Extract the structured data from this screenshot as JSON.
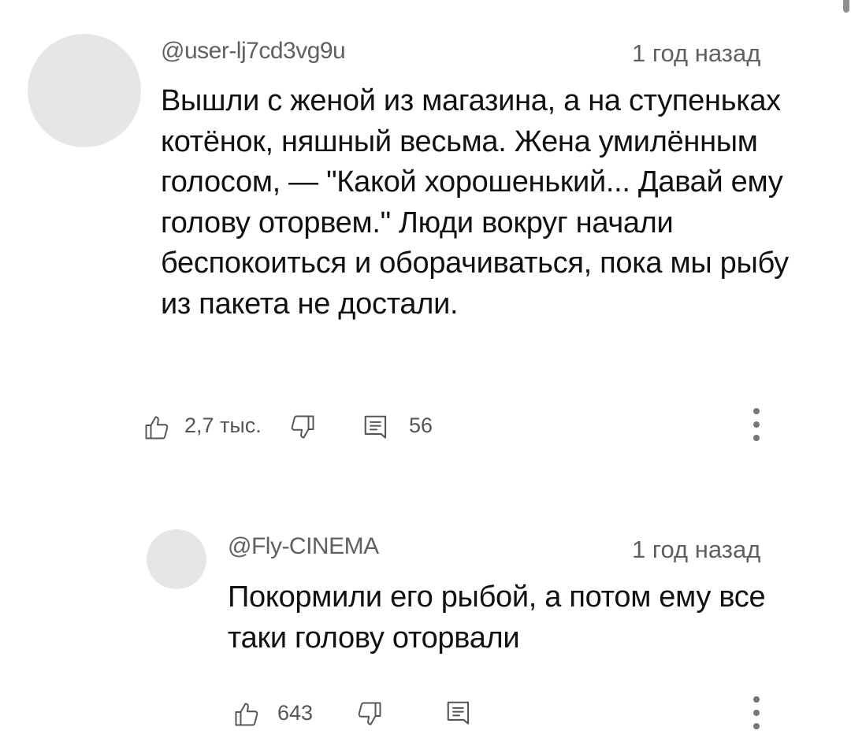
{
  "comments": [
    {
      "username": "@user-lj7cd3vg9u",
      "timestamp": "1 год назад",
      "text": "Вышли с женой из магазина, а на ступеньках котёнок, няшный весьма. Жена умилённым голосом, — \"Какой хорошенький... Давай ему голову оторвем.\" Люди вокруг начали беспокоиться и оборачиваться, пока мы рыбу из пакета не достали.",
      "likes": "2,7 тыс.",
      "replies": "56"
    },
    {
      "username": "@Fly-CINEMA",
      "timestamp": "1 год назад",
      "text": "Покормили его рыбой, а потом ему все таки голову оторвали",
      "likes": "643",
      "replies": ""
    }
  ],
  "icons": {
    "like": "thumbs-up-icon",
    "dislike": "thumbs-down-icon",
    "reply": "comment-icon",
    "more": "more-vertical-icon"
  },
  "colors": {
    "text": "#111111",
    "meta": "#606060",
    "avatar_placeholder": "#e6e6e6",
    "icon": "#555555"
  }
}
